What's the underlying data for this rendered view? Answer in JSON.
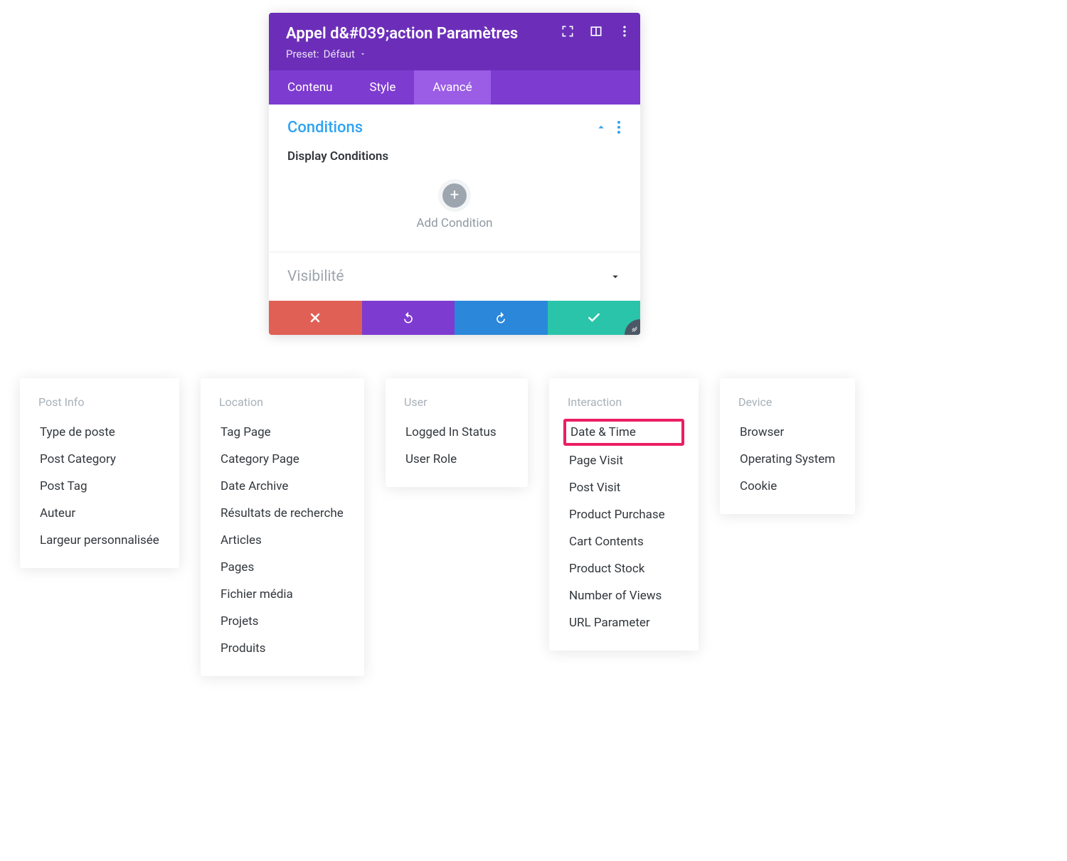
{
  "panel": {
    "title": "Appel d&#039;action Paramètres",
    "preset_prefix": "Preset:",
    "preset_value": "Défaut"
  },
  "tabs": {
    "content": "Contenu",
    "style": "Style",
    "advanced": "Avancé"
  },
  "conditions": {
    "title": "Conditions",
    "subtitle": "Display Conditions",
    "add_label": "Add Condition"
  },
  "visibility": {
    "title": "Visibilité"
  },
  "cards": {
    "post_info": {
      "title": "Post Info",
      "items": [
        "Type de poste",
        "Post Category",
        "Post Tag",
        "Auteur",
        "Largeur personnalisée"
      ]
    },
    "location": {
      "title": "Location",
      "items": [
        "Tag Page",
        "Category Page",
        "Date Archive",
        "Résultats de recherche",
        "Articles",
        "Pages",
        "Fichier média",
        "Projets",
        "Produits"
      ]
    },
    "user": {
      "title": "User",
      "items": [
        "Logged In Status",
        "User Role"
      ]
    },
    "interaction": {
      "title": "Interaction",
      "items": [
        "Date & Time",
        "Page Visit",
        "Post Visit",
        "Product Purchase",
        "Cart Contents",
        "Product Stock",
        "Number of Views",
        "URL Parameter"
      ],
      "highlight_index": 0
    },
    "device": {
      "title": "Device",
      "items": [
        "Browser",
        "Operating System",
        "Cookie"
      ]
    }
  }
}
